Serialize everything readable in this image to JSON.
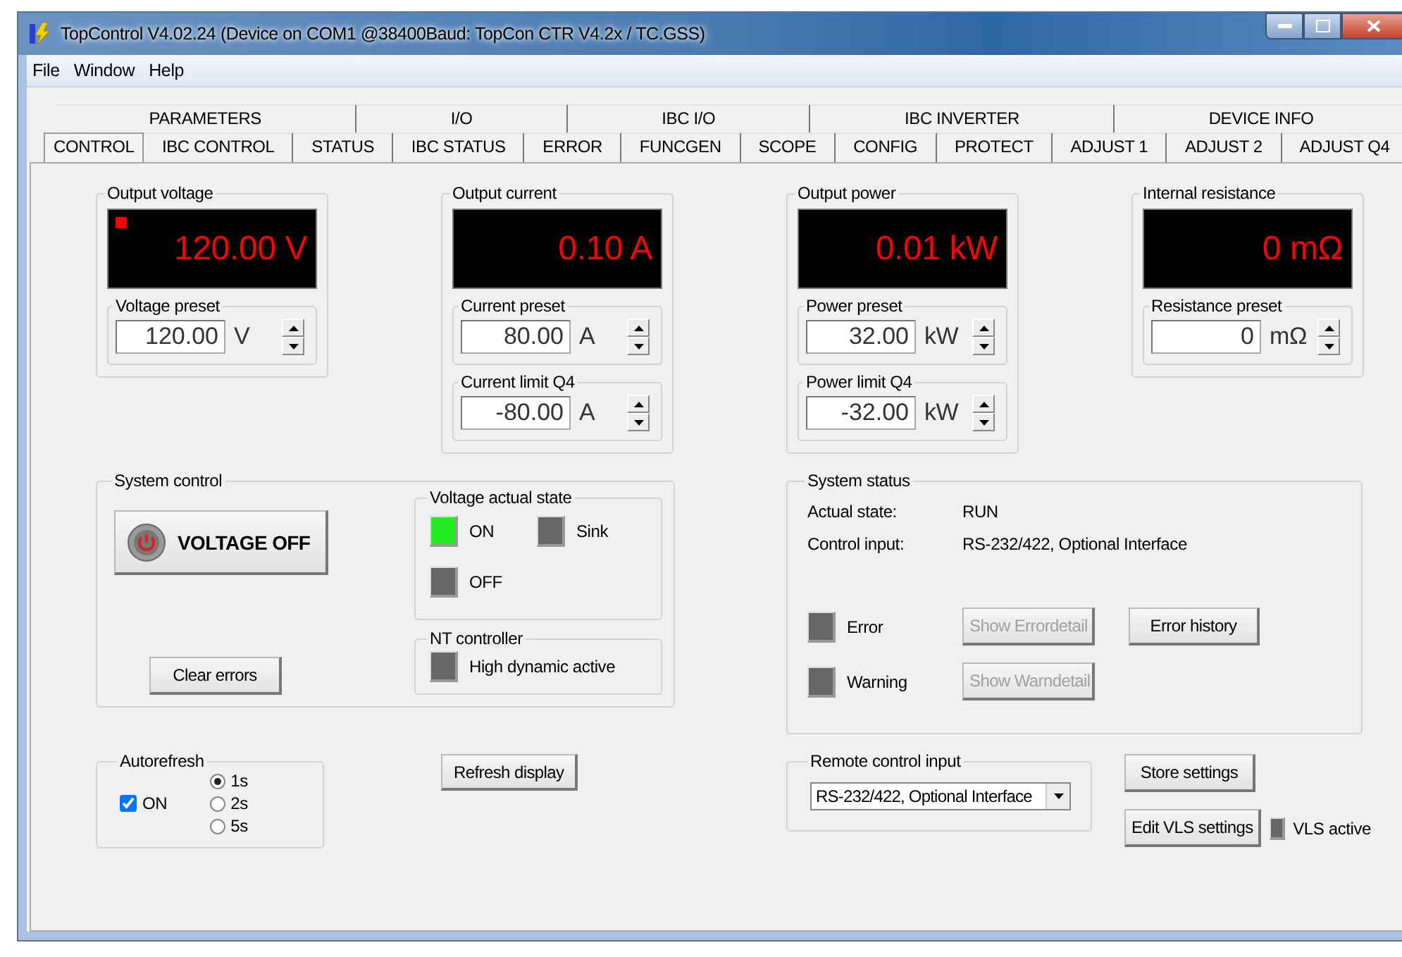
{
  "window": {
    "title": "TopControl V4.02.24 (Device on COM1 @38400Baud: TopCon CTR V4.2x / TC.GSS)"
  },
  "menu": [
    "File",
    "Window",
    "Help"
  ],
  "tabs_back_row": [
    {
      "label": "PARAMETERS",
      "selected": false
    },
    {
      "label": "I/O",
      "selected": false
    },
    {
      "label": "IBC I/O",
      "selected": false
    },
    {
      "label": "IBC INVERTER",
      "selected": false
    },
    {
      "label": "DEVICE INFO",
      "selected": false
    }
  ],
  "tabs_front_row": [
    {
      "label": "CONTROL",
      "selected": true
    },
    {
      "label": "IBC CONTROL",
      "selected": false
    },
    {
      "label": "STATUS",
      "selected": false
    },
    {
      "label": "IBC STATUS",
      "selected": false
    },
    {
      "label": "ERROR",
      "selected": false
    },
    {
      "label": "FUNCGEN",
      "selected": false
    },
    {
      "label": "SCOPE",
      "selected": false
    },
    {
      "label": "CONFIG",
      "selected": false
    },
    {
      "label": "PROTECT",
      "selected": false
    },
    {
      "label": "ADJUST 1",
      "selected": false
    },
    {
      "label": "ADJUST 2",
      "selected": false
    },
    {
      "label": "ADJUST Q4",
      "selected": false
    }
  ],
  "meters": [
    {
      "title": "Output voltage",
      "display": "120.00 V",
      "indicator": true,
      "presets": [
        {
          "label": "Voltage preset",
          "value": "120.00",
          "unit": "V"
        }
      ]
    },
    {
      "title": "Output current",
      "display": "0.10 A",
      "indicator": false,
      "presets": [
        {
          "label": "Current preset",
          "value": "80.00",
          "unit": "A"
        },
        {
          "label": "Current limit Q4",
          "value": "-80.00",
          "unit": "A"
        }
      ]
    },
    {
      "title": "Output power",
      "display": "0.01 kW",
      "indicator": false,
      "presets": [
        {
          "label": "Power preset",
          "value": "32.00",
          "unit": "kW"
        },
        {
          "label": "Power limit Q4",
          "value": "-32.00",
          "unit": "kW"
        }
      ]
    },
    {
      "title": "Internal resistance",
      "display": "0 mΩ",
      "indicator": false,
      "presets": [
        {
          "label": "Resistance preset",
          "value": "0",
          "unit": "mΩ"
        }
      ]
    }
  ],
  "system_control": {
    "title": "System control",
    "power_button": "VOLTAGE OFF",
    "clear_button": "Clear errors",
    "voltage_state": {
      "title": "Voltage actual state",
      "lamps": [
        {
          "label": "ON",
          "on": true
        },
        {
          "label": "Sink",
          "on": false
        },
        {
          "label": "OFF",
          "on": false
        }
      ]
    },
    "nt_controller": {
      "title": "NT controller",
      "lamps": [
        {
          "label": "High dynamic active",
          "on": false
        }
      ]
    }
  },
  "autorefresh": {
    "title": "Autorefresh",
    "checkbox": {
      "label": "ON",
      "checked": true
    },
    "intervals": [
      {
        "label": "1s",
        "selected": true
      },
      {
        "label": "2s",
        "selected": false
      },
      {
        "label": "5s",
        "selected": false
      }
    ]
  },
  "refresh_button": "Refresh display",
  "system_status": {
    "title": "System status",
    "fields": [
      {
        "label": "Actual state:",
        "value": "RUN"
      },
      {
        "label": "Control input:",
        "value": "RS-232/422, Optional Interface"
      }
    ],
    "lamps": [
      {
        "label": "Error",
        "on": false,
        "button": {
          "label": "Show Errordetail",
          "disabled": true
        }
      },
      {
        "label": "Warning",
        "on": false,
        "button": {
          "label": "Show Warndetail",
          "disabled": true
        }
      }
    ],
    "history_button": "Error history"
  },
  "remote_control_input": {
    "title": "Remote control input",
    "value": "RS-232/422, Optional Interface"
  },
  "store_button": "Store settings",
  "vls_button": "Edit VLS settings",
  "vls_lamp": {
    "label": "VLS active",
    "on": false
  }
}
